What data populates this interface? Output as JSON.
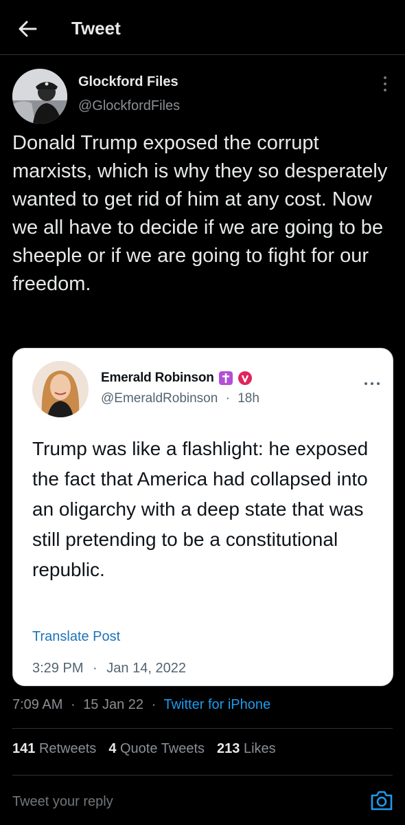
{
  "header": {
    "title": "Tweet",
    "back_icon": "arrow-left-icon"
  },
  "tweet": {
    "author_name": "Glockford Files",
    "author_handle": "@GlockfordFiles",
    "text": "Donald Trump exposed the corrupt marxists, which is why they so desperately wanted to get rid of him at any cost. Now we all have to decide if we are going to be sheeple or if we are going to fight for our freedom.",
    "time": "7:09 AM",
    "date": "15 Jan 22",
    "source": "Twitter for iPhone",
    "separator": "·"
  },
  "quote": {
    "author_name": "Emerald Robinson",
    "badges": [
      "cross-emoji-icon",
      "verified-icon"
    ],
    "author_handle": "@EmeraldRobinson",
    "age": "18h",
    "text": "Trump was like a flashlight: he exposed the fact that America had collapsed into an oligarchy with a deep state that was still pretending to be a constitutional republic.",
    "translate_label": "Translate Post",
    "time": "3:29 PM",
    "date": "Jan 14, 2022",
    "separator": "·"
  },
  "stats": {
    "retweets_count": "141",
    "retweets_label": "Retweets",
    "quotes_count": "4",
    "quotes_label": "Quote Tweets",
    "likes_count": "213",
    "likes_label": "Likes"
  },
  "reply": {
    "placeholder": "Tweet your reply",
    "camera_icon": "camera-icon"
  },
  "colors": {
    "background": "#000000",
    "link": "#1d9bf0",
    "quote_link": "#1d73b8",
    "muted": "#8b8f94",
    "cross_badge": "#b44fd6",
    "verified_badge": "#e0245e"
  }
}
